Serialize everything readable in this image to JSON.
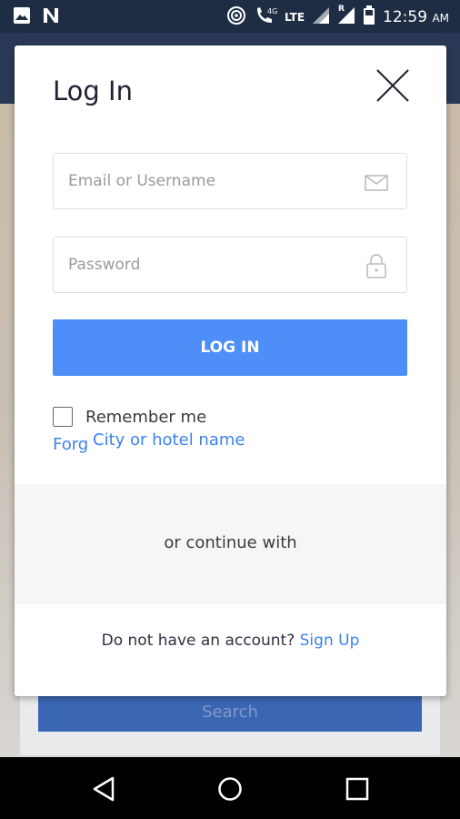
{
  "status_bar": {
    "time": "12:59",
    "ampm": "AM",
    "network": "LTE",
    "net_gen": "4G",
    "roaming": "R",
    "icons": [
      "image-icon",
      "n-app-icon",
      "hotspot-icon",
      "wifi-calling-icon",
      "signal-icon",
      "battery-icon"
    ]
  },
  "background": {
    "search_button_label": "Search"
  },
  "modal": {
    "title": "Log In",
    "email_placeholder": "Email or Username",
    "password_placeholder": "Password",
    "login_button": "LOG IN",
    "remember_label": "Remember me",
    "forgot_link": "Forg",
    "city_hint": "City or hotel name",
    "continue_text": "or continue with",
    "signup_prompt": "Do not have an account?",
    "signup_link": "Sign Up"
  },
  "colors": {
    "accent": "#4d8ef8",
    "link": "#3b82f0",
    "status_bar": "#1e2c44"
  }
}
